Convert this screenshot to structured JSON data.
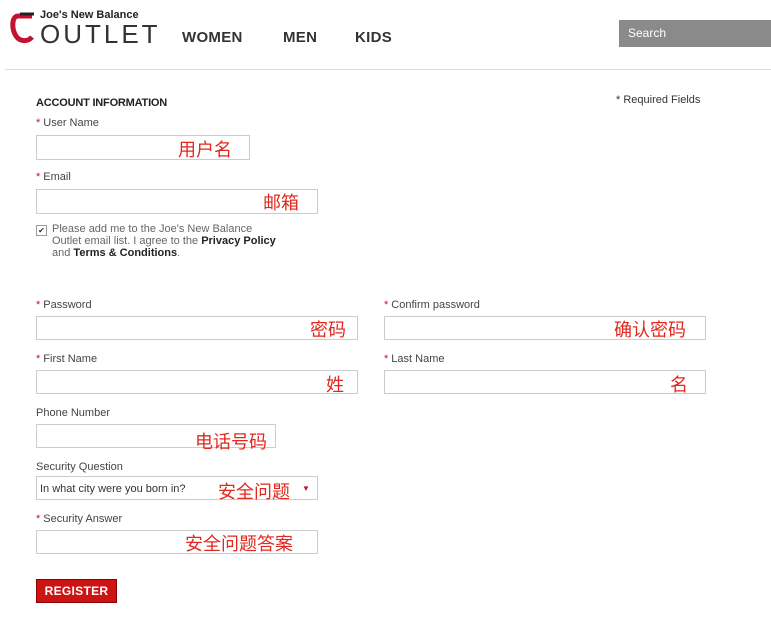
{
  "header": {
    "brand_top": "Joe's New Balance",
    "brand_main": "OUTLET",
    "nav": [
      "WOMEN",
      "MEN",
      "KIDS"
    ],
    "search_placeholder": "Search"
  },
  "form": {
    "section_title": "ACCOUNT INFORMATION",
    "required_note": "* Required Fields",
    "required_mark": "*",
    "fields": {
      "username": {
        "label": "User Name",
        "annotation": "用户名"
      },
      "email": {
        "label": "Email",
        "annotation": "邮箱"
      },
      "password": {
        "label": "Password",
        "annotation": "密码"
      },
      "confirm_password": {
        "label": "Confirm password",
        "annotation": "确认密码"
      },
      "first_name": {
        "label": "First Name",
        "annotation": "姓"
      },
      "last_name": {
        "label": "Last Name",
        "annotation": "名"
      },
      "phone": {
        "label": "Phone Number",
        "annotation": "电话号码"
      },
      "security_question": {
        "label": "Security Question",
        "value": "In what city were you born in?",
        "annotation": "安全问题"
      },
      "security_answer": {
        "label": "Security Answer",
        "annotation": "安全问题答案"
      }
    },
    "optin": {
      "checked": true,
      "text_before": "Please add me to the Joe's New Balance Outlet email list. I agree to the ",
      "privacy_link": "Privacy Policy",
      "and": " and ",
      "terms_link": "Terms & Conditions",
      "period": "."
    },
    "register_label": "REGISTER"
  },
  "colors": {
    "accent": "#cc1414",
    "annotation": "#e0281f",
    "search_bg": "#8a8a8a"
  },
  "icons": {
    "logo": "new-balance-logo-icon",
    "checkbox": "checkmark-icon",
    "select_caret": "triangle-down-icon"
  }
}
